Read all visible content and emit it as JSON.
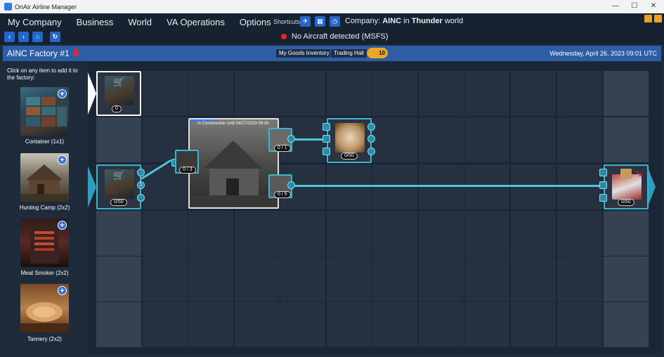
{
  "window": {
    "title": "OnAir Airline Manager"
  },
  "menu": {
    "items": [
      "My Company",
      "Business",
      "World",
      "VA Operations",
      "Options"
    ]
  },
  "shortcuts": {
    "label": "Shortcuts:"
  },
  "company": {
    "prefix": "Company:",
    "name": "AINC",
    "mid": "in",
    "world": "Thunder",
    "suffix": "world"
  },
  "sim": {
    "status": "No Aircraft detected (MSFS)"
  },
  "header": {
    "title": "AINC Factory #1",
    "goods_inventory": "My Goods Inventory",
    "trading_hall": "Trading Hall",
    "level": "10",
    "datetime": "Wednesday, April 26, 2023 09:01 UTC"
  },
  "sidebar": {
    "hint": "Click on any item to add it to the factory:",
    "items": [
      {
        "label": "Container (1x1)"
      },
      {
        "label": "Hunting Camp (2x2)"
      },
      {
        "label": "Meat Smoker (2x2)"
      },
      {
        "label": "Tannery (2x2)"
      }
    ]
  },
  "grid": {
    "input_top": {
      "count": "0"
    },
    "input_mid": {
      "count": "0/50"
    },
    "hunting_camp": {
      "status": "In Construction until 04/27/2023 09:20"
    },
    "camp_in": {
      "count": "0 / 3"
    },
    "camp_out1": {
      "count": "0 / 1"
    },
    "camp_out2": {
      "count": "0 / 5"
    },
    "fur_storage": {
      "count": "0/50"
    },
    "output": {
      "count": "0/50"
    },
    "badge": "1"
  },
  "colors": {
    "accent": "#2e5da8",
    "link": "#4cc6dc",
    "alert": "#e02828",
    "level": "#e8a826"
  }
}
